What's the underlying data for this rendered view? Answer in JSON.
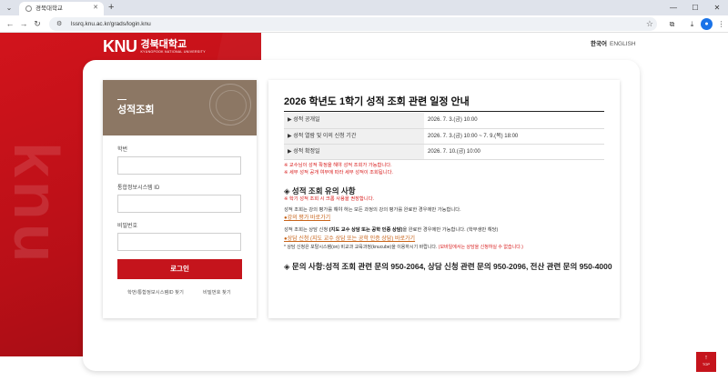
{
  "browser": {
    "tab_title": "경북대학교",
    "url": "lssrq.knu.ac.kr/grads/login.knu"
  },
  "colors": {
    "brand_red": "#c5141c",
    "login_header": "#8c7764",
    "note_red": "#d81a1a",
    "link_orange": "#c8641a"
  },
  "header": {
    "logo_mark": "KNU",
    "logo_kor": "경북대학교",
    "logo_eng": "KYUNGPOOK NATIONAL UNIVERSITY",
    "lang_ko": "한국어",
    "lang_en": "ENGLISH"
  },
  "login": {
    "title": "성적조회",
    "student_id_label": "학번",
    "portal_id_label": "통합정보시스템 ID",
    "password_label": "비밀번호",
    "login_button": "로그인",
    "find_id_link": "학번/통합정보시스템ID 찾기",
    "find_pw_link": "비밀번호 찾기"
  },
  "notice": {
    "title": "2026 학년도 1학기 성적 조회 관련 일정 안내",
    "schedule": [
      {
        "label": "▶ 성적 공개일",
        "value": "2026. 7. 3.(금) 10:00"
      },
      {
        "label": "▶ 성적 열람 및 이의 신청 기간",
        "value": "2026. 7. 3.(금) 10:00 ~ 7. 9.(목) 18:00"
      },
      {
        "label": "▶ 성적 확정일",
        "value": "2026. 7. 10.(금) 10:00"
      }
    ],
    "red_note_1": "※ 교수님이 성적 확정을 해야 성적 조회가 가능합니다.",
    "red_note_2": "※ 세부 성적 공개 여부에 따라 세부 성적이 조회됩니다.",
    "caution_title": "◈ 성적 조회 유의 사항",
    "caution_red": "※ 학기 성적 조회 시 크롬 사용을 권장합니다.",
    "caution_text_1": "성적 조회는 강의 평가를 해야 하는 모든 과정의 강의 평가를 완료한 경우에만 가능합니다.",
    "eval_link": "●강의 평가 바로가기",
    "caution_text_2_pre": "성적 조회는 상담 신청 ",
    "caution_text_2_bold": "(지도 교수 상담 또는 공학 인증 상담)",
    "caution_text_2_post": "을 완료한 경우에만 가능합니다. (학부생만 해당)",
    "counsel_link": "●상담 신청 (지도 교수 상담 또는 공학 인증 상담) 바로가기",
    "small_note_pre": "* 상담 신청은 포탈시스템(on) 비교과 교육과정(knucube)을 이용하시기 바랍니다. ",
    "small_note_red": "(모바일에서는 상담을 신청하실 수 없습니다.)",
    "contact": "◈ 문의 사항:성적 조회 관련 문의 950-2064, 상담 신청 관련 문의 950-2096, 전산 관련 문의 950-4000"
  },
  "top_button": {
    "arrow": "↑",
    "label": "TOP"
  }
}
